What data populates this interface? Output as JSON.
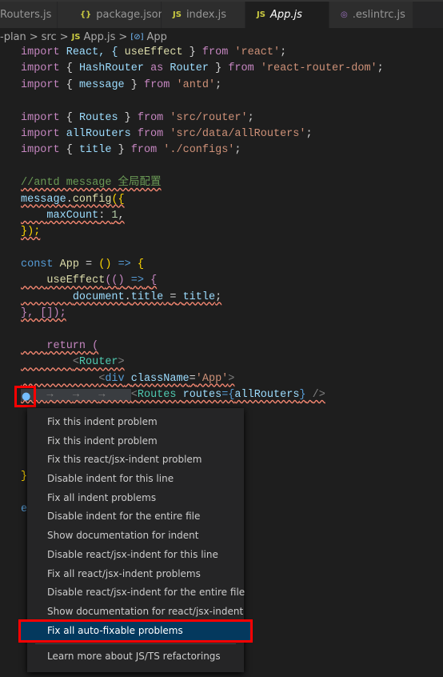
{
  "tabs": [
    {
      "label": "Routers.js",
      "icon": "js-icon"
    },
    {
      "label": "package.json",
      "icon": "json-icon",
      "glyph": "{}"
    },
    {
      "label": "index.js",
      "icon": "js-icon",
      "glyph": "JS"
    },
    {
      "label": "App.js",
      "icon": "js-icon",
      "glyph": "JS",
      "active": true,
      "close": "✕"
    },
    {
      "label": ".eslintrc.js",
      "icon": "eslint-icon",
      "glyph": "◎"
    }
  ],
  "breadcrumb": {
    "items": [
      "-plan",
      "src",
      "App.js",
      "App"
    ],
    "sep": ">",
    "js": "JS",
    "sym": "[⊘]"
  },
  "code": {
    "l1": [
      "import",
      "React, {",
      "useEffect",
      "}",
      "from",
      "'react'",
      ";"
    ],
    "l2": [
      "import",
      "{",
      "HashRouter",
      "as",
      "Router",
      "}",
      "from",
      "'react-router-dom'",
      ";"
    ],
    "l3": [
      "import",
      "{",
      "message",
      "}",
      "from",
      "'antd'",
      ";"
    ],
    "l5": [
      "import",
      "{",
      "Routes",
      "}",
      "from",
      "'src/router'",
      ";"
    ],
    "l6": [
      "import",
      "allRouters",
      "from",
      "'src/data/allRouters'",
      ";"
    ],
    "l7": [
      "import",
      "{",
      "title",
      "}",
      "from",
      "'./configs'",
      ";"
    ],
    "l9": "//antd message 全局配置",
    "l10": [
      "message",
      ".",
      "config",
      "({"
    ],
    "l11": [
      "maxCount",
      ": ",
      "1",
      ","
    ],
    "l12": "});",
    "l14": [
      "const",
      "App",
      "=",
      "()",
      "=>",
      "{"
    ],
    "l15": [
      "useEffect",
      "((",
      ")",
      "=>",
      "{"
    ],
    "l16": [
      "document",
      ".",
      "title",
      "=",
      "title",
      ";"
    ],
    "l17": "}, []);",
    "l19": [
      "return",
      "("
    ],
    "l20": [
      "<",
      "Router",
      ">"
    ],
    "l21": [
      "<",
      "div",
      "className",
      "=",
      "'App'",
      ">"
    ],
    "l22": [
      "→",
      "<",
      "Routes",
      "routes",
      "={",
      "allRouters",
      "}",
      "/>"
    ],
    "l27": "}",
    "l29": "e"
  },
  "menu": {
    "items": [
      "Fix this indent problem",
      "Fix this indent problem",
      "Fix this react/jsx-indent problem",
      "Disable indent for this line",
      "Fix all indent problems",
      "Disable indent for the entire file",
      "Show documentation for indent",
      "Disable react/jsx-indent for this line",
      "Fix all react/jsx-indent problems",
      "Disable react/jsx-indent for the entire file",
      "Show documentation for react/jsx-indent",
      "Fix all auto-fixable problems"
    ],
    "selected_index": 11,
    "footer": "Learn more about JS/TS refactorings"
  },
  "colors": {
    "highlight_box": "#ff0000",
    "selected_bg": "#04395e",
    "squiggle": "#f48771"
  }
}
